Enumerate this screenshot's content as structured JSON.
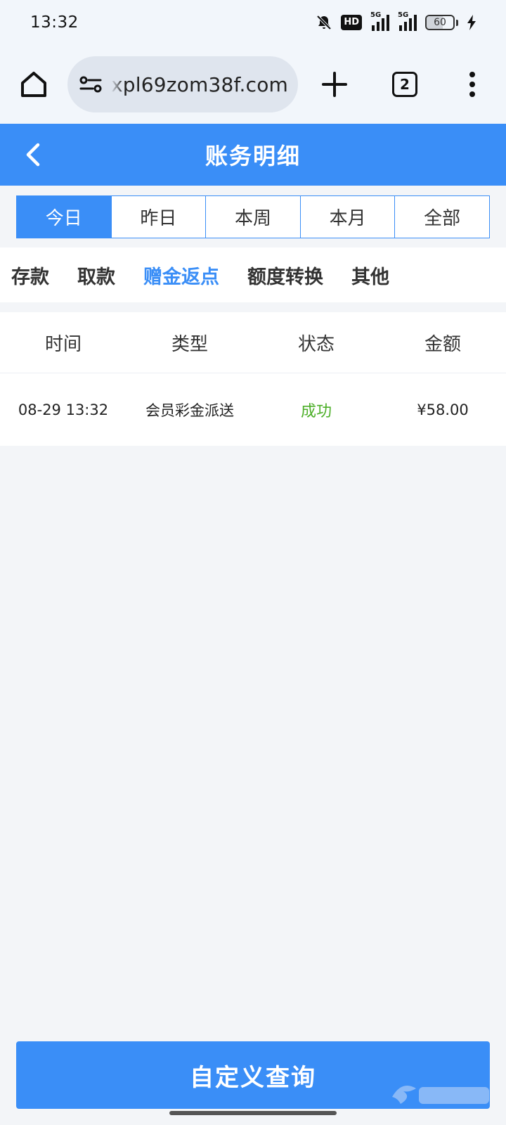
{
  "status_bar": {
    "time": "13:32",
    "icons": [
      "bell-off-icon",
      "hd-icon",
      "signal-5g-icon",
      "signal-5g-icon",
      "battery-icon",
      "charging-icon"
    ],
    "hd_label": "HD",
    "net_label": "5G",
    "battery_level": "60"
  },
  "browser": {
    "url": "xpl69zom38f.com",
    "tab_count": "2",
    "icons": [
      "home-icon",
      "site-settings-icon",
      "plus-icon",
      "tabs-icon",
      "more-vert-icon"
    ]
  },
  "header": {
    "title": "账务明细",
    "back_icon": "chevron-left-icon"
  },
  "period_tabs": [
    {
      "label": "今日",
      "active": true
    },
    {
      "label": "昨日",
      "active": false
    },
    {
      "label": "本周",
      "active": false
    },
    {
      "label": "本月",
      "active": false
    },
    {
      "label": "全部",
      "active": false
    }
  ],
  "category_tabs": [
    {
      "label": "存款",
      "active": false
    },
    {
      "label": "取款",
      "active": false
    },
    {
      "label": "赠金返点",
      "active": true
    },
    {
      "label": "额度转换",
      "active": false
    },
    {
      "label": "其他",
      "active": false
    }
  ],
  "table": {
    "columns": [
      "时间",
      "类型",
      "状态",
      "金额"
    ],
    "rows": [
      {
        "time": "08-29 13:32",
        "type": "会员彩金派送",
        "status": "成功",
        "amount": "¥58.00"
      }
    ]
  },
  "query_button": {
    "label": "自定义查询"
  },
  "colors": {
    "primary": "#3a8ef7",
    "success": "#4caf28",
    "background": "#f3f5f8"
  }
}
